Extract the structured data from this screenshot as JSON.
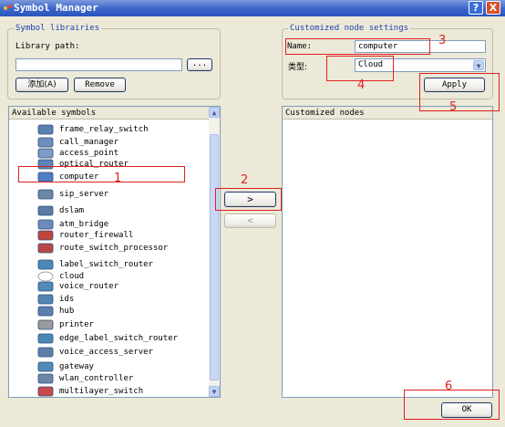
{
  "window": {
    "title": "Symbol Manager",
    "help": "?",
    "close": "X"
  },
  "library": {
    "group_title": "Symbol librairies",
    "path_label": "Library path:",
    "path_value": "",
    "browse": "...",
    "add": "添加(A)",
    "remove": "Remove"
  },
  "settings": {
    "group_title": "Customized node settings",
    "name_label": "Name:",
    "name_value": "computer",
    "type_label": "类型:",
    "type_value": "Cloud",
    "apply": "Apply"
  },
  "available": {
    "header": "Available symbols",
    "items": [
      {
        "label": "frame_relay_switch",
        "icon": "frame-relay-switch-icon",
        "color": "#5b7fb0"
      },
      {
        "label": "call_manager",
        "icon": "call-manager-icon",
        "color": "#6d8fbe"
      },
      {
        "label": "access_point",
        "icon": "access-point-icon",
        "color": "#7c9bc6"
      },
      {
        "label": "optical_router",
        "icon": "optical-router-icon",
        "color": "#5a86b8"
      },
      {
        "label": "computer",
        "icon": "computer-icon",
        "color": "#4f7dc4"
      },
      {
        "label": "sip_server",
        "icon": "sip-server-icon",
        "color": "#6a86a8"
      },
      {
        "label": "dslam",
        "icon": "dslam-icon",
        "color": "#5c7aa4"
      },
      {
        "label": "atm_bridge",
        "icon": "atm-bridge-icon",
        "color": "#6b8cb8"
      },
      {
        "label": "router_firewall",
        "icon": "router-firewall-icon",
        "color": "#c0463c"
      },
      {
        "label": "route_switch_processor",
        "icon": "route-switch-processor-icon",
        "color": "#b84848"
      },
      {
        "label": "label_switch_router",
        "icon": "label-switch-router-icon",
        "color": "#4c88b4"
      },
      {
        "label": "cloud",
        "icon": "cloud-icon",
        "color": "#ffffff"
      },
      {
        "label": "voice_router",
        "icon": "voice-router-icon",
        "color": "#4f8ab8"
      },
      {
        "label": "ids",
        "icon": "ids-icon",
        "color": "#5384b0"
      },
      {
        "label": "hub",
        "icon": "hub-icon",
        "color": "#5b7fae"
      },
      {
        "label": "printer",
        "icon": "printer-icon",
        "color": "#9a9a9a"
      },
      {
        "label": "edge_label_switch_router",
        "icon": "edge-label-switch-router-icon",
        "color": "#4c88b4"
      },
      {
        "label": "voice_access_server",
        "icon": "voice-access-server-icon",
        "color": "#5d7fa8"
      },
      {
        "label": "gateway",
        "icon": "gateway-icon",
        "color": "#4f8ab8"
      },
      {
        "label": "wlan_controller",
        "icon": "wlan-controller-icon",
        "color": "#6a86a8"
      },
      {
        "label": "multilayer_switch",
        "icon": "multilayer-switch-icon",
        "color": "#c94848"
      }
    ]
  },
  "transfer": {
    "add": ">",
    "remove": "<"
  },
  "customized": {
    "header": "Customized nodes",
    "items": []
  },
  "ok": "OK",
  "annotations": [
    "1",
    "2",
    "3",
    "4",
    "5",
    "6"
  ],
  "colors": {
    "annotation": "#e02020",
    "selection_box": "#e02020"
  }
}
